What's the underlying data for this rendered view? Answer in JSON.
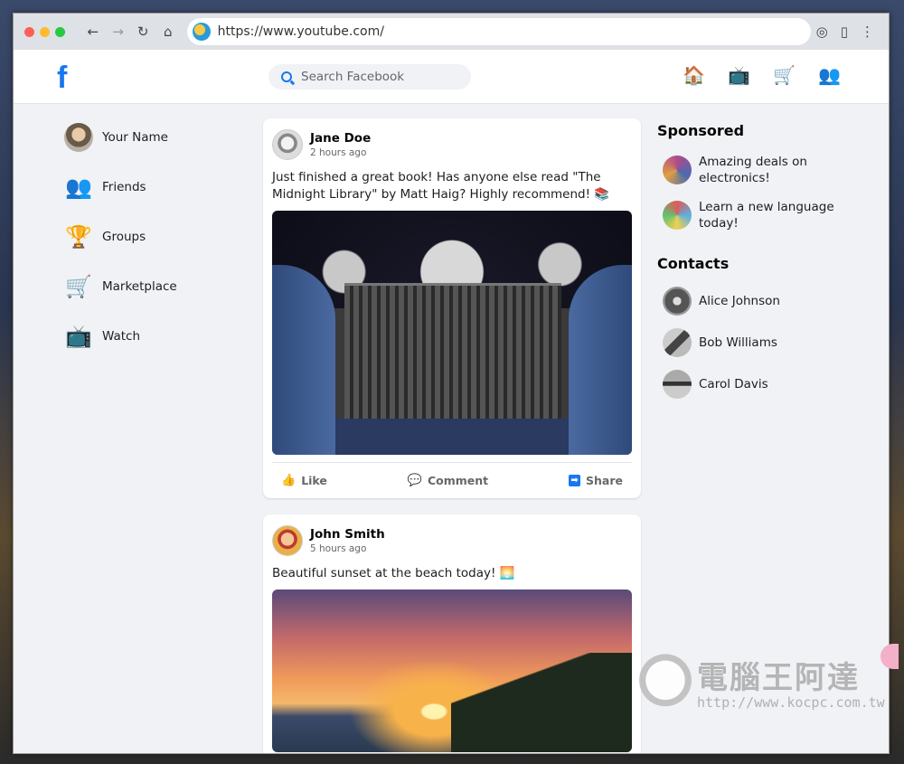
{
  "browser": {
    "url": "https://www.youtube.com/",
    "dot_colors": [
      "#ff5f57",
      "#febc2e",
      "#28c840"
    ]
  },
  "header": {
    "logo": "f",
    "search_placeholder": "Search Facebook",
    "icons": [
      "home-icon",
      "tv-icon",
      "cart-icon",
      "friends-icon"
    ]
  },
  "sidebar": {
    "items": [
      {
        "label": "Your Name",
        "icon": "avatar"
      },
      {
        "label": "Friends",
        "icon": "friends-icon"
      },
      {
        "label": "Groups",
        "icon": "trophy-icon"
      },
      {
        "label": "Marketplace",
        "icon": "cart-icon"
      },
      {
        "label": "Watch",
        "icon": "tv-icon"
      }
    ]
  },
  "feed": {
    "posts": [
      {
        "author": "Jane Doe",
        "time": "2 hours ago",
        "text": "Just finished a great book! Has anyone else read \"The Midnight Library\" by Matt Haig? Highly recommend! 📚",
        "image": "library-illustration"
      },
      {
        "author": "John Smith",
        "time": "5 hours ago",
        "text": "Beautiful sunset at the beach today! 🌅",
        "image": "sunset-photo"
      }
    ],
    "actions": {
      "like": "Like",
      "comment": "Comment",
      "share": "Share"
    }
  },
  "right": {
    "sponsored_title": "Sponsored",
    "sponsored": [
      {
        "text": "Amazing deals on electronics!"
      },
      {
        "text": "Learn a new language today!"
      }
    ],
    "contacts_title": "Contacts",
    "contacts": [
      {
        "name": "Alice Johnson"
      },
      {
        "name": "Bob Williams"
      },
      {
        "name": "Carol Davis"
      }
    ]
  },
  "watermark": {
    "title": "電腦王阿達",
    "url": "http://www.kocpc.com.tw"
  },
  "colors": {
    "brand": "#1877f2",
    "background": "#f0f2f5"
  }
}
